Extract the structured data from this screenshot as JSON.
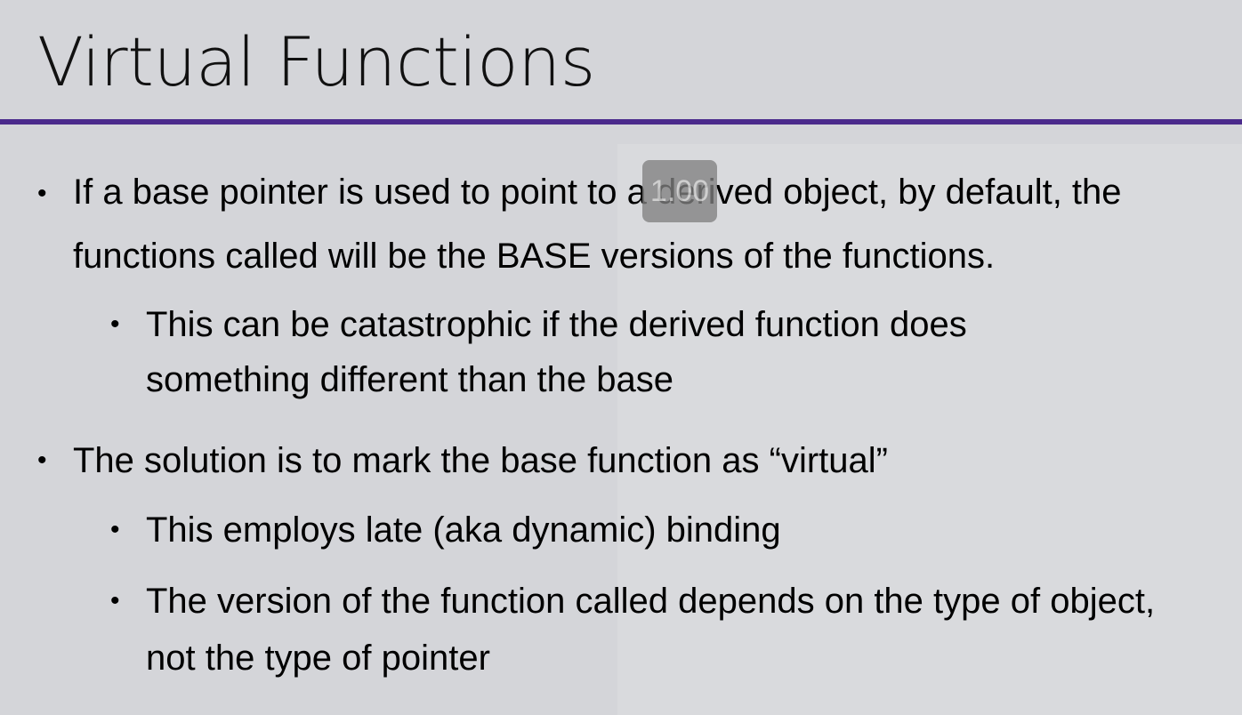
{
  "slide": {
    "title": "Virtual Functions",
    "accent_color": "#4b2a8c",
    "bullets": [
      {
        "level": 1,
        "text": "If a base pointer is used to point to a derived object, by default, the functions called will be the BASE versions of the functions."
      },
      {
        "level": 2,
        "text": "This can be catastrophic if the derived function does something different than the base"
      },
      {
        "level": 1,
        "text": "The solution is to mark the base function as “virtual”"
      },
      {
        "level": 2,
        "text": "This employs late (aka dynamic) binding"
      },
      {
        "level": 2,
        "text": "The version of the function called depends on the type of object, not the type of pointer"
      }
    ],
    "bullet_glyph": "•"
  },
  "overlay": {
    "playback_speed": "1.00"
  }
}
